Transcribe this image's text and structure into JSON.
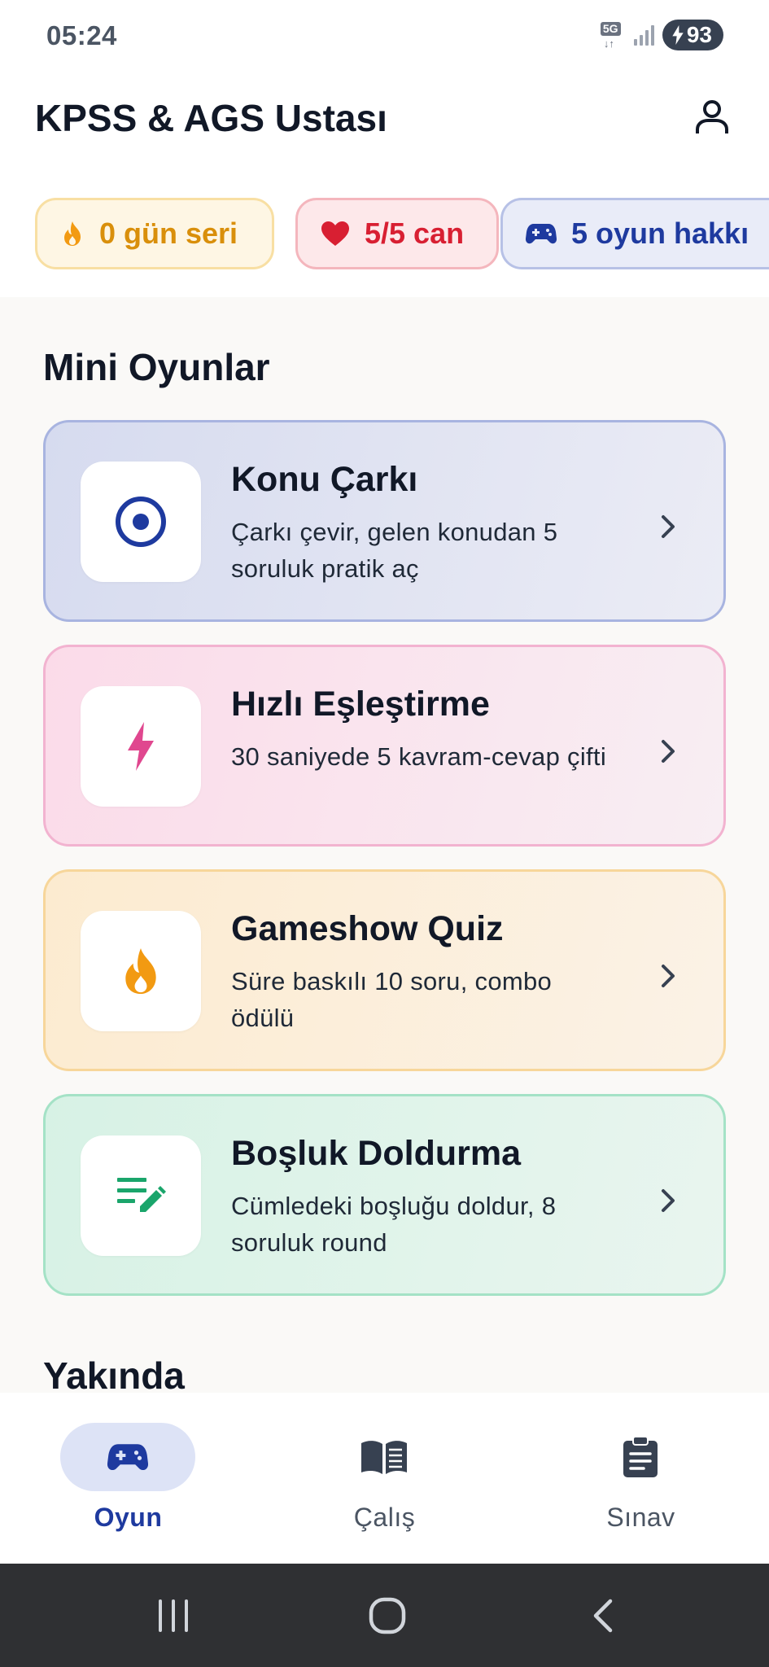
{
  "status_bar": {
    "time": "05:24",
    "network": "5G",
    "battery": "93"
  },
  "header": {
    "title": "KPSS & AGS Ustası",
    "profile_icon": "person-icon"
  },
  "stats": {
    "streak": {
      "label": "0 gün seri",
      "icon": "flame-icon",
      "color": "#d98f0b"
    },
    "lives": {
      "label": "5/5 can",
      "icon": "heart-icon",
      "color": "#d81f32"
    },
    "games": {
      "label": "5 oyun hakkı",
      "icon": "gamepad-icon",
      "color": "#1e3a9f"
    }
  },
  "main": {
    "games_section_title": "Mini Oyunlar",
    "soon_section_title": "Yakında",
    "games": [
      {
        "title": "Konu Çarkı",
        "description": "Çarkı çevir, gelen konudan 5 soruluk pratik aç",
        "icon": "target-icon",
        "accent": "#1e3a9f"
      },
      {
        "title": "Hızlı Eşleştirme",
        "description": "30 saniyede 5 kavram-cevap çifti",
        "icon": "lightning-icon",
        "accent": "#e0478f"
      },
      {
        "title": "Gameshow Quiz",
        "description": "Süre baskılı 10 soru, combo ödülü",
        "icon": "flame-icon",
        "accent": "#f29a12"
      },
      {
        "title": "Boşluk Doldurma",
        "description": "Cümledeki boşluğu doldur, 8 soruluk round",
        "icon": "edit-note-icon",
        "accent": "#1aa56b"
      }
    ]
  },
  "bottom_nav": {
    "items": [
      {
        "label": "Oyun",
        "icon": "gamepad-icon",
        "active": true
      },
      {
        "label": "Çalış",
        "icon": "book-icon",
        "active": false
      },
      {
        "label": "Sınav",
        "icon": "clipboard-icon",
        "active": false
      }
    ]
  }
}
